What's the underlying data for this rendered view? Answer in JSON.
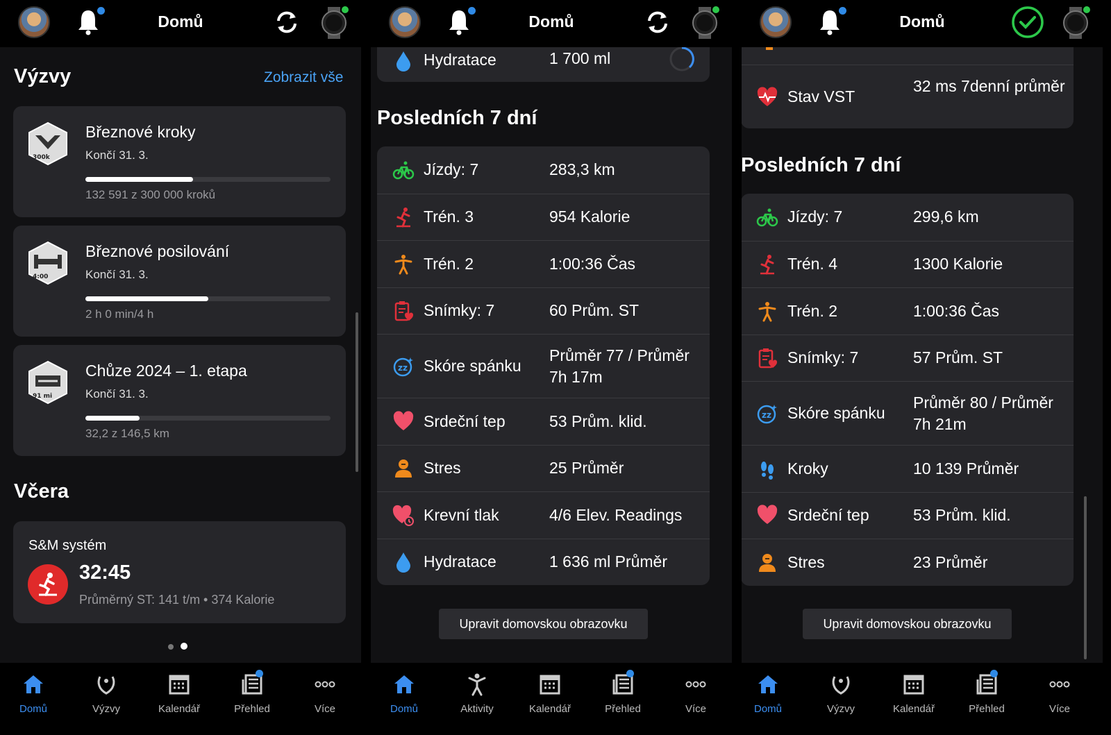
{
  "header": {
    "title": "Domů"
  },
  "panel1": {
    "challenges_title": "Výzvy",
    "show_all": "Zobrazit vše",
    "challenges": [
      {
        "title": "Březnové kroky",
        "ends": "Končí 31. 3.",
        "progress": "132 591 z 300 000 kroků",
        "fraction": 0.44,
        "badge_text": "300k"
      },
      {
        "title": "Březnové posilování",
        "ends": "Končí 31. 3.",
        "progress": "2 h 0 min/4 h",
        "fraction": 0.5,
        "badge_text": "4:00"
      },
      {
        "title": "Chůze 2024 – 1. etapa",
        "ends": "Končí 31. 3.",
        "progress": "32,2 z 146,5 km",
        "fraction": 0.22,
        "badge_text": "91 mi"
      }
    ],
    "yesterday_title": "Včera",
    "activity": {
      "name": "S&M systém",
      "time": "32:45",
      "details": "Průměrný ST: 141 t/m • 374 Kalorie"
    }
  },
  "panel2": {
    "hydration_top": {
      "label": "Hydratace",
      "value": "1 700 ml"
    },
    "section_title": "Posledních 7 dní",
    "rows": [
      {
        "icon": "bike-icon",
        "label": "Jízdy: 7",
        "value": "283,3 km"
      },
      {
        "icon": "strength-icon",
        "label": "Trén. 3",
        "value": "954 Kalorie"
      },
      {
        "icon": "cardio-icon",
        "label": "Trén. 2",
        "value": "1:00:36 Čas"
      },
      {
        "icon": "clipboard-icon",
        "label": "Snímky: 7",
        "value": "60 Prům. ST"
      },
      {
        "icon": "sleep-icon",
        "label": "Skóre spánku",
        "value": "Průměr 77 / Průměr 7h 17m"
      },
      {
        "icon": "heart-icon",
        "label": "Srdeční tep",
        "value": "53 Prům. klid."
      },
      {
        "icon": "stress-icon",
        "label": "Stres",
        "value": "25 Průměr"
      },
      {
        "icon": "blood-pressure-icon",
        "label": "Krevní tlak",
        "value": "4/6 Elev. Readings"
      },
      {
        "icon": "drop-icon",
        "label": "Hydratace",
        "value": "1 636 ml Průměr"
      }
    ],
    "edit_button": "Upravit domovskou obrazovku"
  },
  "panel3": {
    "hrv_row": {
      "label": "Stav VST",
      "value": "32 ms 7denní průměr"
    },
    "section_title": "Posledních 7 dní",
    "rows": [
      {
        "icon": "bike-icon",
        "label": "Jízdy: 7",
        "value": "299,6 km"
      },
      {
        "icon": "strength-icon",
        "label": "Trén. 4",
        "value": "1300 Kalorie"
      },
      {
        "icon": "cardio-icon",
        "label": "Trén. 2",
        "value": "1:00:36 Čas"
      },
      {
        "icon": "clipboard-icon",
        "label": "Snímky: 7",
        "value": "57 Prům. ST"
      },
      {
        "icon": "sleep-icon",
        "label": "Skóre spánku",
        "value": "Průměr 80 / Průměr 7h 21m"
      },
      {
        "icon": "footsteps-icon",
        "label": "Kroky",
        "value": "10 139 Průměr"
      },
      {
        "icon": "heart-icon",
        "label": "Srdeční tep",
        "value": "53 Prům. klid."
      },
      {
        "icon": "stress-icon",
        "label": "Stres",
        "value": "23 Průměr"
      }
    ],
    "edit_button": "Upravit domovskou obrazovku"
  },
  "nav1": [
    "Domů",
    "Výzvy",
    "Kalendář",
    "Přehled",
    "Více"
  ],
  "nav2": [
    "Domů",
    "Aktivity",
    "Kalendář",
    "Přehled",
    "Více"
  ],
  "nav3": [
    "Domů",
    "Výzvy",
    "Kalendář",
    "Přehled",
    "Více"
  ],
  "colors": {
    "accent": "#3c8ef0",
    "link": "#4aa3f5",
    "green": "#2cc84a",
    "red": "#e02a2a",
    "orange": "#f08a1c",
    "card": "#26262a"
  }
}
